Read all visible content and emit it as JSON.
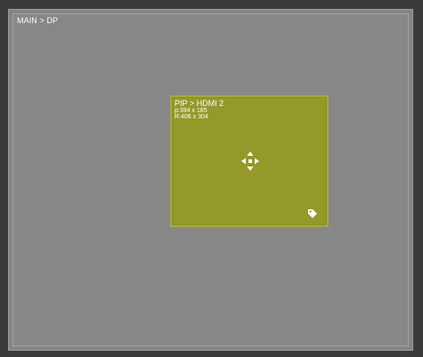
{
  "main": {
    "label": "MAIN > DP"
  },
  "pip": {
    "title": "PIP > HDMI 2",
    "position_text": "p:394 x 185",
    "resolution_text": "R:406 x 304",
    "move_icon": "move-arrows-icon",
    "tag_icon": "tag-icon"
  },
  "colors": {
    "frame": "#3b3b3b",
    "main_background": "#878787",
    "pip_background": "#94992a",
    "text": "#ffffff"
  }
}
